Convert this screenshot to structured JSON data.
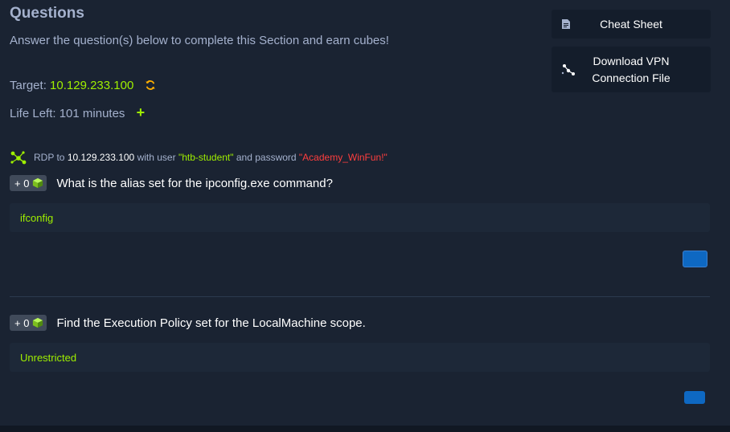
{
  "header": {
    "title": "Questions",
    "subtitle": "Answer the question(s) below to complete this Section and earn cubes!"
  },
  "target": {
    "label": "Target:",
    "ip": "10.129.233.100",
    "refresh_icon": "refresh-icon"
  },
  "life": {
    "label": "Life Left: 101 minutes",
    "extend_icon": "plus-icon"
  },
  "sidebar": {
    "cheat_sheet": "Cheat Sheet",
    "vpn_line1": "Download VPN",
    "vpn_line2": "Connection File"
  },
  "rdp": {
    "prefix": "RDP to",
    "ip": "10.129.233.100",
    "mid1": "with user",
    "user": "\"htb-student\"",
    "mid2": "and password",
    "password": "\"Academy_WinFun!\""
  },
  "questions": [
    {
      "badge": "+ 0",
      "text": "What is the alias set for the ipconfig.exe command?",
      "answer": "ifconfig"
    },
    {
      "badge": "+ 0",
      "text": "Find the Execution Policy set for the LocalMachine scope.",
      "answer": "Unrestricted"
    }
  ],
  "colors": {
    "background": "#1a2332",
    "accent_green": "#9fef00",
    "password_red": "#ff3e3e",
    "submit_blue": "#0e68c2"
  }
}
